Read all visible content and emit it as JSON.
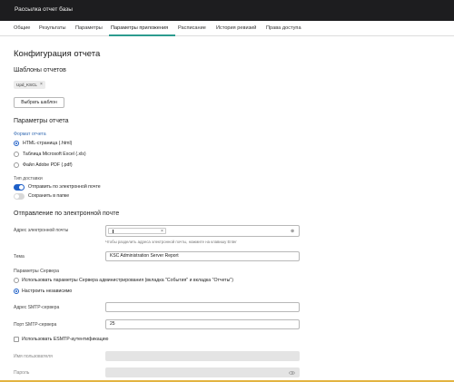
{
  "window": {
    "title": "Рассылка отчет базы"
  },
  "tabs": [
    {
      "label": "Общие"
    },
    {
      "label": "Результаты"
    },
    {
      "label": "Параметры"
    },
    {
      "label": "Параметры приложения"
    },
    {
      "label": "Расписание"
    },
    {
      "label": "История ревизий"
    },
    {
      "label": "Права доступа"
    }
  ],
  "page": {
    "title": "Конфигурация отчета"
  },
  "templates": {
    "heading": "Шаблоны отчетов",
    "chip_label": "Upd_KSCL",
    "select_button": "Выбрать шаблон"
  },
  "report_params": {
    "heading": "Параметры отчета",
    "format_caption": "Формат отчета",
    "formats": [
      {
        "label": "HTML-страница (.html)",
        "selected": true
      },
      {
        "label": "Таблица Microsoft Excel (.xls)",
        "selected": false
      },
      {
        "label": "Файл Adobe PDF (.pdf)",
        "selected": false
      }
    ],
    "delivery_caption": "Тип доставки",
    "delivery": [
      {
        "label": "Отправить по электронной почте",
        "on": true
      },
      {
        "label": "Сохранить в папке",
        "on": false
      }
    ]
  },
  "email": {
    "heading": "Отправление по электронной почте",
    "address_label": "Адрес электронной почты",
    "address_hint": "Чтобы разделить адреса электронной почты, нажмите на клавишу Enter",
    "subject_label": "Тема",
    "subject_value": "KSC Administration Server Report",
    "server_params_caption": "Параметры Сервера",
    "server_options": [
      {
        "label": "Использовать параметры Сервера администрирования (вкладка \"События\" и вкладка \"Отчеты\")",
        "selected": false
      },
      {
        "label": "Настроить независимо",
        "selected": true
      }
    ],
    "smtp_server_label": "Адрес SMTP-сервера",
    "smtp_server_value": "",
    "smtp_port_label": "Порт SMTP-сервера",
    "smtp_port_value": "25",
    "esmtp_label": "Использовать ESMTP-аутентификацию",
    "username_label": "Имя пользователя",
    "password_label": "Пароль"
  },
  "colors": {
    "accent": "#1e5fc7",
    "tab_underline": "#2c9b8f",
    "titlebar": "#1d1d1f"
  }
}
